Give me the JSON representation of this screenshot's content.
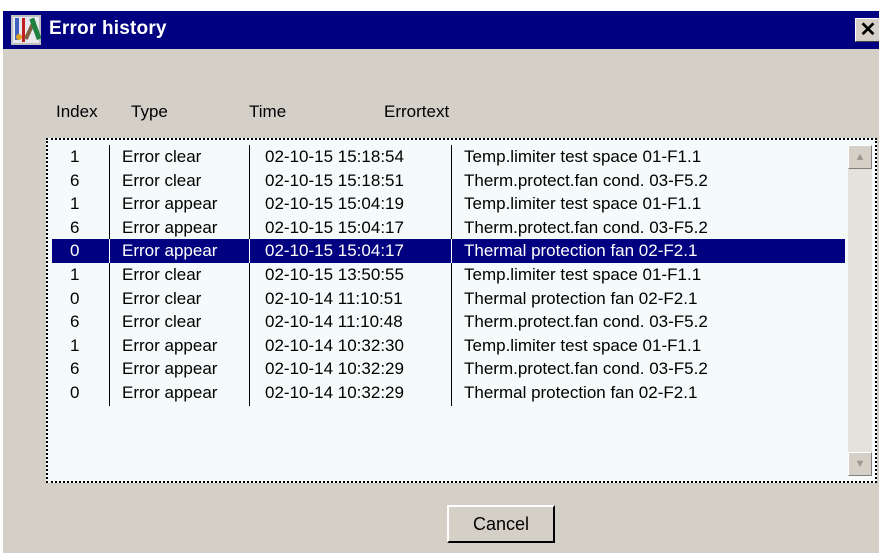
{
  "window": {
    "title": "Error history",
    "close_glyph": "✕"
  },
  "columns": {
    "index": "Index",
    "type": "Type",
    "time": "Time",
    "errortext": "Errortext"
  },
  "rows": [
    {
      "index": "1",
      "type": "Error clear",
      "time": "02-10-15 15:18:54",
      "text": "Temp.limiter test space 01-F1.1"
    },
    {
      "index": "6",
      "type": "Error clear",
      "time": "02-10-15 15:18:51",
      "text": "Therm.protect.fan cond. 03-F5.2"
    },
    {
      "index": "1",
      "type": "Error appear",
      "time": "02-10-15 15:04:19",
      "text": "Temp.limiter test space 01-F1.1"
    },
    {
      "index": "6",
      "type": "Error appear",
      "time": "02-10-15 15:04:17",
      "text": "Therm.protect.fan cond. 03-F5.2"
    },
    {
      "index": "0",
      "type": "Error appear",
      "time": "02-10-15 15:04:17",
      "text": "Thermal protection fan  02-F2.1",
      "selected": true
    },
    {
      "index": "1",
      "type": "Error clear",
      "time": "02-10-15 13:50:55",
      "text": "Temp.limiter test space 01-F1.1"
    },
    {
      "index": "0",
      "type": "Error clear",
      "time": "02-10-14 11:10:51",
      "text": "Thermal protection fan  02-F2.1"
    },
    {
      "index": "6",
      "type": "Error clear",
      "time": "02-10-14 11:10:48",
      "text": "Therm.protect.fan cond. 03-F5.2"
    },
    {
      "index": "1",
      "type": "Error appear",
      "time": "02-10-14 10:32:30",
      "text": "Temp.limiter test space 01-F1.1"
    },
    {
      "index": "6",
      "type": "Error appear",
      "time": "02-10-14 10:32:29",
      "text": "Therm.protect.fan cond. 03-F5.2"
    },
    {
      "index": "0",
      "type": "Error appear",
      "time": "02-10-14 10:32:29",
      "text": "Thermal protection fan  02-F2.1"
    }
  ],
  "buttons": {
    "cancel": "Cancel"
  },
  "colors": {
    "titlebar": "#000080",
    "selection": "#000080",
    "face": "#d4d0c8",
    "list_bg": "#f5fbfb"
  },
  "icons": {
    "app": "wrench-tools-icon",
    "close": "close-icon",
    "scroll_up": "scroll-up-arrow-icon",
    "scroll_down": "scroll-down-arrow-icon"
  }
}
